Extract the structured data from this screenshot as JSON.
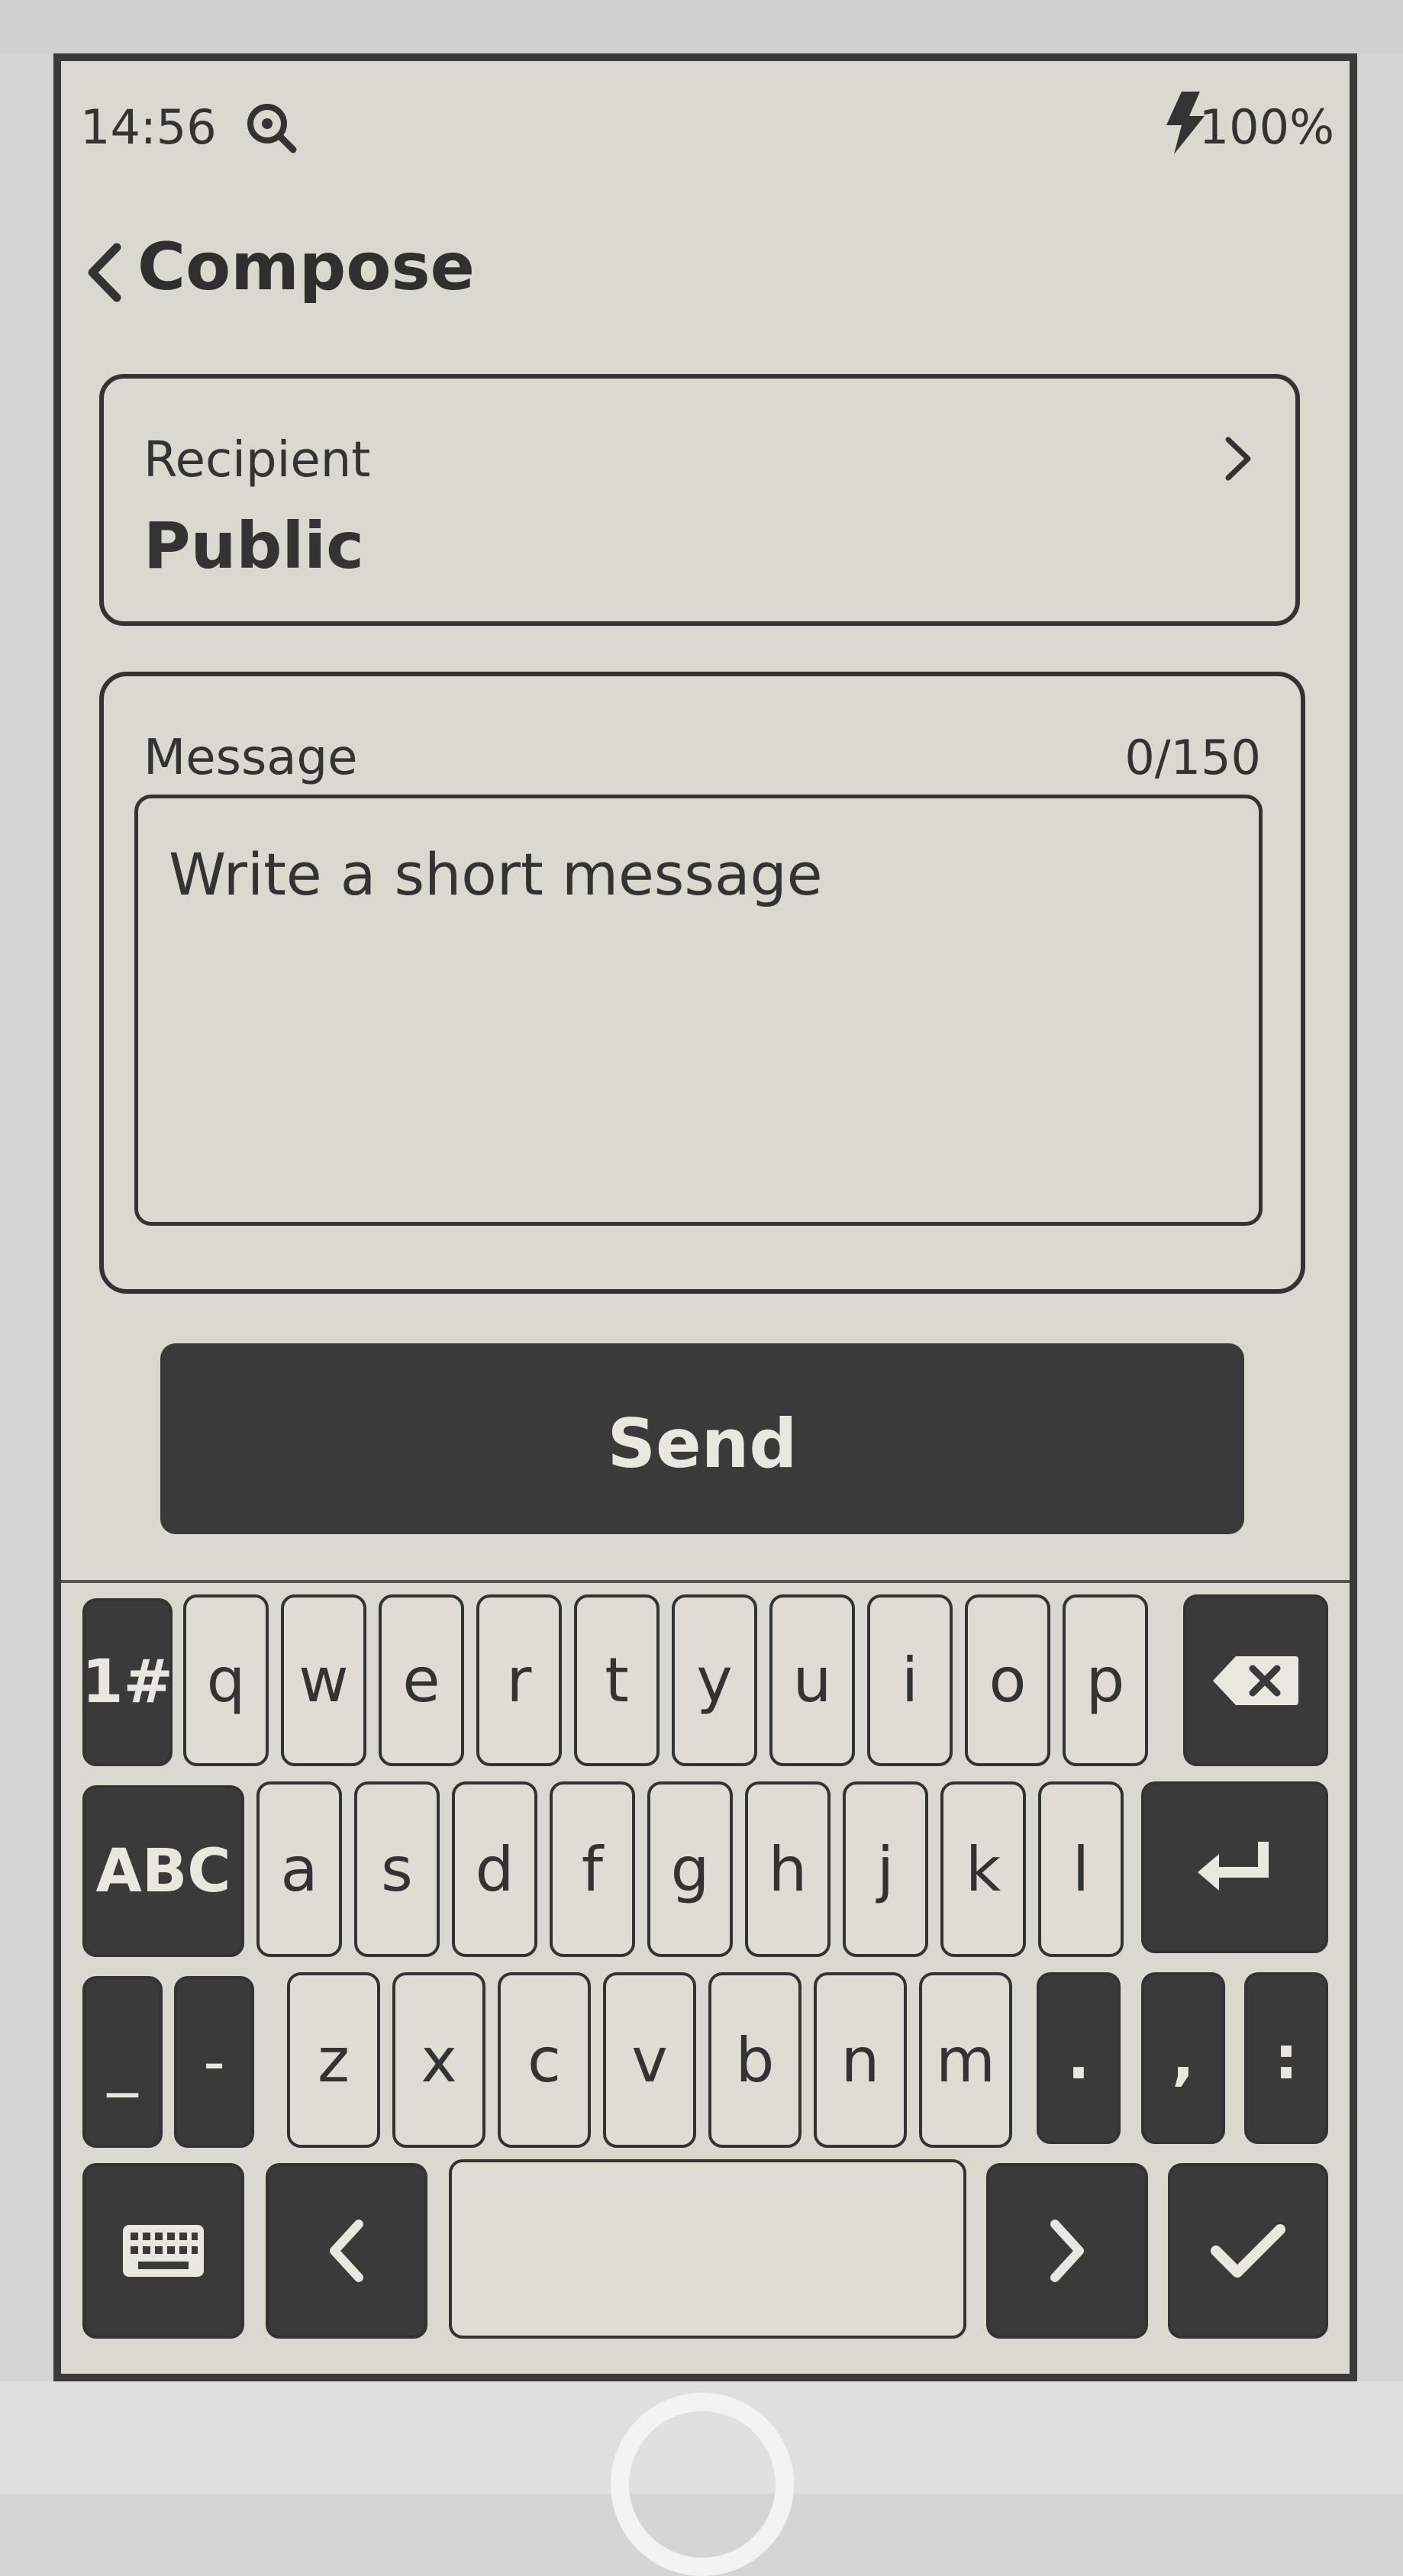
{
  "status_bar": {
    "time": "14:56",
    "battery": "100%"
  },
  "header": {
    "title": "Compose"
  },
  "recipient": {
    "label": "Recipient",
    "value": "Public"
  },
  "message": {
    "label": "Message",
    "counter": "0/150",
    "placeholder": "Write a short message"
  },
  "send": {
    "label": "Send"
  },
  "keyboard": {
    "row1_mode_key": "1#",
    "row1": [
      "q",
      "w",
      "e",
      "r",
      "t",
      "y",
      "u",
      "i",
      "o",
      "p"
    ],
    "row2_mode_key": "ABC",
    "row2": [
      "a",
      "s",
      "d",
      "f",
      "g",
      "h",
      "j",
      "k",
      "l"
    ],
    "row3_left": [
      "_",
      "-"
    ],
    "row3": [
      "z",
      "x",
      "c",
      "v",
      "b",
      "n",
      "m"
    ],
    "row3_right": [
      ".",
      ",",
      ":"
    ]
  },
  "colors": {
    "screen_bg": "#d9d9d0",
    "ink": "#333333",
    "dark_key": "#3a3a3a"
  }
}
